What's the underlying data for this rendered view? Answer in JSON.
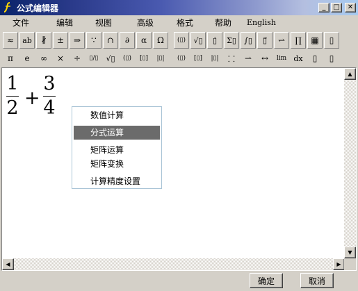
{
  "window": {
    "title": "公式编辑器",
    "minimize_glyph": "_",
    "maximize_glyph": "□",
    "close_glyph": "✕"
  },
  "menu": [
    {
      "label": "文件"
    },
    {
      "label": "编辑"
    },
    {
      "label": "视图"
    },
    {
      "label": "高级"
    },
    {
      "label": "格式"
    },
    {
      "label": "帮助"
    },
    {
      "label": "English"
    }
  ],
  "toolbar_row1": [
    {
      "glyph": "≈",
      "icon": "relation-symbols-icon"
    },
    {
      "glyph": "ab",
      "icon": "spacing-icon"
    },
    {
      "glyph": "∦",
      "icon": "embellishments-icon"
    },
    {
      "glyph": "±",
      "icon": "operators-icon"
    },
    {
      "glyph": "⇒",
      "icon": "arrows-icon"
    },
    {
      "glyph": "∵",
      "icon": "logic-symbols-icon"
    },
    {
      "glyph": "∩",
      "icon": "set-theory-icon"
    },
    {
      "glyph": "∂",
      "icon": "misc-symbols-icon"
    },
    {
      "glyph": "α",
      "icon": "greek-lowercase-icon"
    },
    {
      "glyph": "Ω",
      "icon": "greek-uppercase-icon"
    },
    {
      "glyph": "(▯)",
      "icon": "fence-templates-icon"
    },
    {
      "glyph": "√▯",
      "icon": "fraction-radical-icon"
    },
    {
      "glyph": "▯̇",
      "icon": "subscript-superscript-icon"
    },
    {
      "glyph": "Σ▯",
      "icon": "summation-icon"
    },
    {
      "glyph": "∫▯",
      "icon": "integral-icon"
    },
    {
      "glyph": "▯⃗",
      "icon": "overbar-underbar-icon"
    },
    {
      "glyph": "⥋",
      "icon": "labeled-arrow-icon"
    },
    {
      "glyph": "∏",
      "icon": "products-sets-icon"
    },
    {
      "glyph": "▦",
      "icon": "matrix-icon"
    },
    {
      "glyph": "▯",
      "icon": "misc-templates-icon"
    }
  ],
  "toolbar_row2": [
    {
      "glyph": "π",
      "icon": "pi-icon"
    },
    {
      "glyph": "e",
      "icon": "e-constant-icon"
    },
    {
      "glyph": "∞",
      "icon": "infinity-icon"
    },
    {
      "glyph": "×",
      "icon": "times-icon"
    },
    {
      "glyph": "÷",
      "icon": "divide-icon"
    },
    {
      "glyph": "▯/▯",
      "icon": "fraction-template-icon"
    },
    {
      "glyph": "√▯",
      "icon": "square-root-icon"
    },
    {
      "glyph": "(▯)",
      "icon": "parentheses-icon"
    },
    {
      "glyph": "[▯]",
      "icon": "brackets-icon"
    },
    {
      "glyph": "|▯|",
      "icon": "absolute-value-icon"
    },
    {
      "glyph": "(▯)",
      "icon": "paren-matrix-icon"
    },
    {
      "glyph": "[▯]",
      "icon": "bracket-matrix-icon"
    },
    {
      "glyph": "|▯|",
      "icon": "determinant-icon"
    },
    {
      "glyph": "⸬",
      "icon": "matrix-dots-icon"
    },
    {
      "glyph": "⇀",
      "icon": "vector-arrow-icon"
    },
    {
      "glyph": "↔",
      "icon": "double-arrow-icon"
    },
    {
      "glyph": "lim",
      "icon": "limit-icon"
    },
    {
      "glyph": "dx",
      "icon": "differential-icon"
    },
    {
      "glyph": "▯",
      "icon": "box-template-icon"
    },
    {
      "glyph": "▯",
      "icon": "stack-template-icon"
    }
  ],
  "formula": {
    "frac1_num": "1",
    "frac1_den": "2",
    "operator": "+",
    "frac2_num": "3",
    "frac2_den": "4"
  },
  "context_menu": {
    "items": [
      {
        "label": "数值计算",
        "selected": false
      },
      {
        "label": "分式运算",
        "selected": true
      },
      {
        "label": "矩阵运算",
        "selected": false
      },
      {
        "label": "矩阵变换",
        "selected": false
      },
      {
        "label": "计算精度设置",
        "selected": false
      }
    ]
  },
  "dialog": {
    "ok_label": "确定",
    "cancel_label": "取消"
  },
  "colors": {
    "title_gradient_start": "#0a246a",
    "title_gradient_end": "#a6caf0",
    "chrome": "#d4d0c8",
    "menu_selected": "#6b6b6b"
  }
}
